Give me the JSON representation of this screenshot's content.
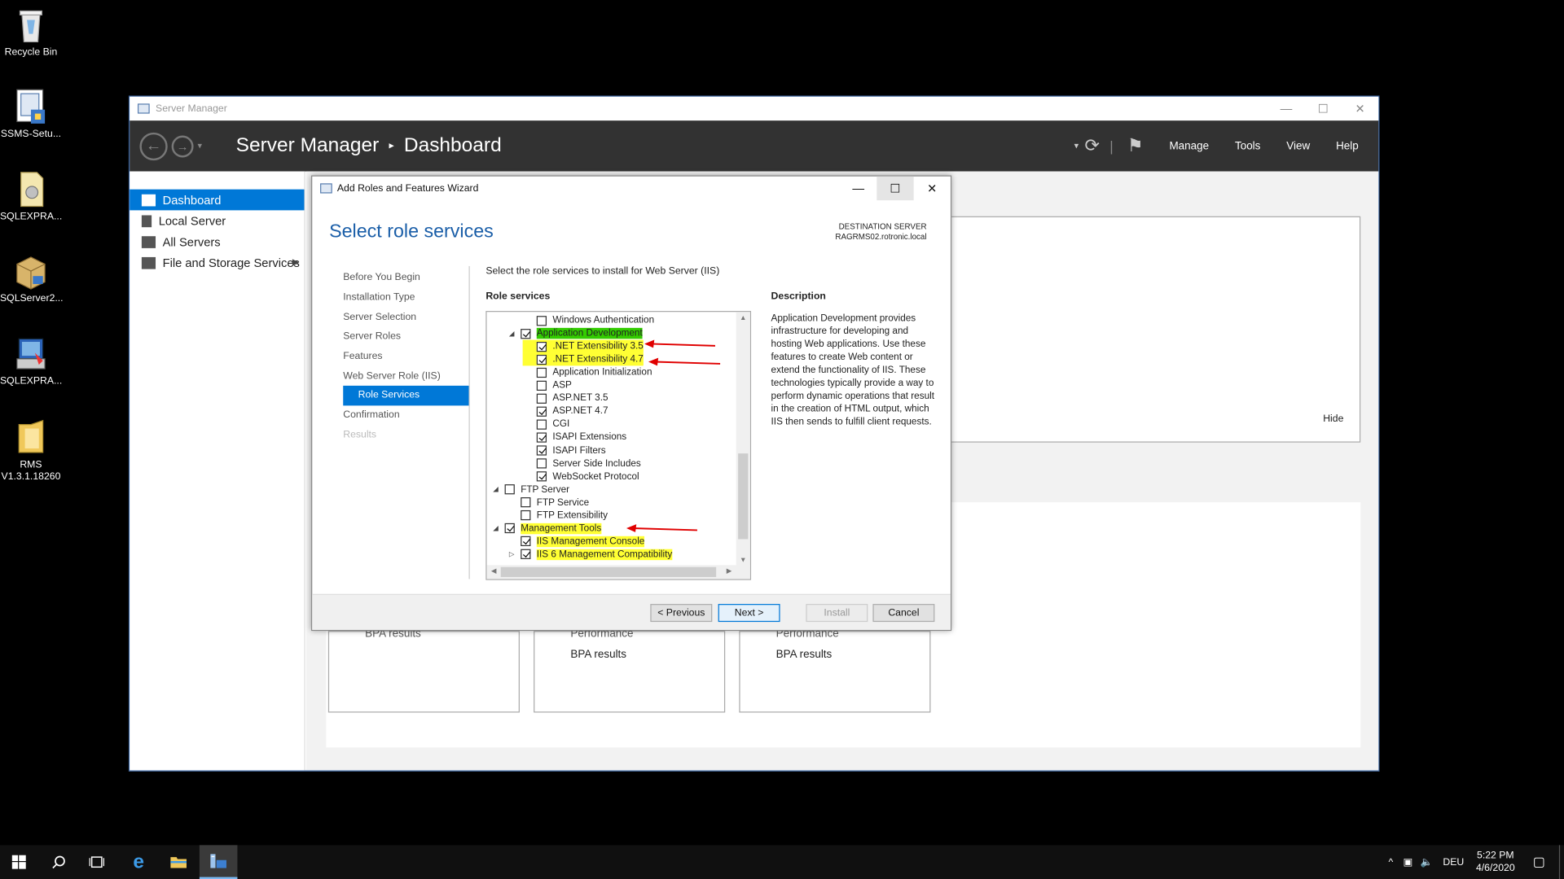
{
  "desktop": {
    "icons": [
      {
        "label": "Recycle Bin",
        "icon": "recycle-bin-icon"
      },
      {
        "label": "SSMS-Setu...",
        "icon": "installer-icon"
      },
      {
        "label": "SQLEXPRA...",
        "icon": "document-icon"
      },
      {
        "label": "SQLServer2...",
        "icon": "package-icon"
      },
      {
        "label": "SQLEXPRA...",
        "icon": "setup-icon"
      },
      {
        "label": "RMS\nV1.3.1.18260",
        "icon": "folder-icon"
      }
    ]
  },
  "server_manager": {
    "title": "Server Manager",
    "breadcrumb": {
      "root": "Server Manager",
      "sep": "▸",
      "page": "Dashboard"
    },
    "menu": {
      "manage": "Manage",
      "tools": "Tools",
      "view": "View",
      "help": "Help"
    },
    "sidebar": {
      "items": [
        {
          "label": "Dashboard"
        },
        {
          "label": "Local Server"
        },
        {
          "label": "All Servers"
        },
        {
          "label": "File and Storage Services"
        }
      ]
    },
    "main": {
      "hide_label": "Hide",
      "tiles": [
        {
          "line1": "BPA results",
          "line2": ""
        },
        {
          "line1": "Performance",
          "line2": "BPA results"
        },
        {
          "line1": "Performance",
          "line2": "BPA results"
        }
      ]
    }
  },
  "wizard": {
    "title": "Add Roles and Features Wizard",
    "heading": "Select role services",
    "destination_label": "DESTINATION SERVER",
    "destination_server": "RAGRMS02.rotronic.local",
    "nav": [
      {
        "label": "Before You Begin",
        "state": "normal"
      },
      {
        "label": "Installation Type",
        "state": "normal"
      },
      {
        "label": "Server Selection",
        "state": "normal"
      },
      {
        "label": "Server Roles",
        "state": "normal"
      },
      {
        "label": "Features",
        "state": "normal"
      },
      {
        "label": "Web Server Role (IIS)",
        "state": "normal"
      },
      {
        "label": "Role Services",
        "state": "active"
      },
      {
        "label": "Confirmation",
        "state": "normal"
      },
      {
        "label": "Results",
        "state": "disabled"
      }
    ],
    "instruction": "Select the role services to install for Web Server (IIS)",
    "role_services_label": "Role services",
    "description_label": "Description",
    "description": "Application Development provides infrastructure for developing and hosting Web applications. Use these features to create Web content or extend the functionality of IIS. These technologies typically provide a way to perform dynamic operations that result in the creation of HTML output, which IIS then sends to fulfill client requests.",
    "tree": [
      {
        "label": "Windows Authentication",
        "level": 3,
        "checked": false,
        "expander": "",
        "highlight": ""
      },
      {
        "label": "Application Development",
        "level": 2,
        "checked": true,
        "expander": "◢",
        "highlight": "green"
      },
      {
        "label": ".NET Extensibility 3.5",
        "level": 3,
        "checked": true,
        "expander": "",
        "highlight": "yellow"
      },
      {
        "label": ".NET Extensibility 4.7",
        "level": 3,
        "checked": true,
        "expander": "",
        "highlight": "yellow"
      },
      {
        "label": "Application Initialization",
        "level": 3,
        "checked": false,
        "expander": "",
        "highlight": ""
      },
      {
        "label": "ASP",
        "level": 3,
        "checked": false,
        "expander": "",
        "highlight": ""
      },
      {
        "label": "ASP.NET 3.5",
        "level": 3,
        "checked": false,
        "expander": "",
        "highlight": ""
      },
      {
        "label": "ASP.NET 4.7",
        "level": 3,
        "checked": true,
        "expander": "",
        "highlight": ""
      },
      {
        "label": "CGI",
        "level": 3,
        "checked": false,
        "expander": "",
        "highlight": ""
      },
      {
        "label": "ISAPI Extensions",
        "level": 3,
        "checked": true,
        "expander": "",
        "highlight": ""
      },
      {
        "label": "ISAPI Filters",
        "level": 3,
        "checked": true,
        "expander": "",
        "highlight": ""
      },
      {
        "label": "Server Side Includes",
        "level": 3,
        "checked": false,
        "expander": "",
        "highlight": ""
      },
      {
        "label": "WebSocket Protocol",
        "level": 3,
        "checked": true,
        "expander": "",
        "highlight": ""
      },
      {
        "label": "FTP Server",
        "level": 1,
        "checked": false,
        "expander": "◢",
        "highlight": ""
      },
      {
        "label": "FTP Service",
        "level": 2,
        "checked": false,
        "expander": "",
        "highlight": ""
      },
      {
        "label": "FTP Extensibility",
        "level": 2,
        "checked": false,
        "expander": "",
        "highlight": ""
      },
      {
        "label": "Management Tools",
        "level": 1,
        "checked": true,
        "expander": "◢",
        "highlight": "yellow"
      },
      {
        "label": "IIS Management Console",
        "level": 2,
        "checked": true,
        "expander": "",
        "highlight": "yellow"
      },
      {
        "label": "IIS 6 Management Compatibility",
        "level": 2,
        "checked": true,
        "expander": "▷",
        "highlight": "yellow"
      }
    ],
    "buttons": {
      "previous": "< Previous",
      "next": "Next >",
      "install": "Install",
      "cancel": "Cancel"
    }
  },
  "taskbar": {
    "language": "DEU",
    "time": "5:22 PM",
    "date": "4/6/2020"
  },
  "colors": {
    "accent": "#0078d7",
    "heading": "#1a5ea8",
    "highlight_yellow": "#ffff33",
    "highlight_green": "#33cc00",
    "annotation_arrow": "#e00000"
  }
}
